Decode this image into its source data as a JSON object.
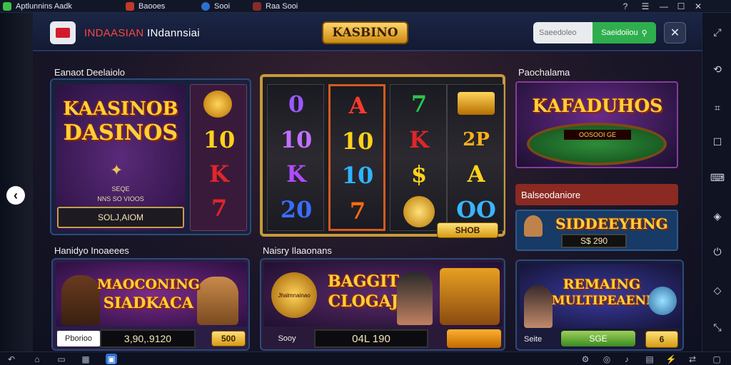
{
  "system_tabs": [
    {
      "label": "Aptlunnins Aadk"
    },
    {
      "label": "Baooes"
    },
    {
      "label": "Sooi"
    },
    {
      "label": "Raa Sooi"
    }
  ],
  "app": {
    "brand_red": "INDAASIAN",
    "brand_white": "INdannsiai",
    "center_logo": "KASBINO",
    "search": {
      "placeholder": "Saeedoleo",
      "button_label": "Saeidoiiou"
    }
  },
  "panels": {
    "top_left": {
      "title": "Eanaot Deelaiolo",
      "headline_1": "KAASINOB",
      "headline_2": "DASINOS",
      "sub_1": "SEQE",
      "sub_2": "NNS SO VIOOS",
      "cta": "SOLJ,AIOM",
      "symbols": [
        "10",
        "K",
        "7"
      ]
    },
    "slot": {
      "reels": [
        [
          "0",
          "10",
          "K",
          "20"
        ],
        [
          "A",
          "10",
          "10",
          "7"
        ],
        [
          "7",
          "K",
          "$"
        ],
        [
          "2P",
          "A",
          "OO"
        ]
      ],
      "spin_label": "SHOB"
    },
    "top_right": {
      "title": "Paochalama",
      "headline": "KAFADUHOS",
      "table_text": "OOSOOI GE",
      "subtitle": "Balseodaniore",
      "promo": "SIDDEEYHNG",
      "promo_value": "S$ 290"
    },
    "bottom_left": {
      "title": "Hanidyo Inoaeees",
      "headline_1": "MAOCONING",
      "headline_2": "SIADKACA",
      "label": "Pborioo",
      "amount": "3,90,.9120",
      "badge": "500"
    },
    "bottom_center": {
      "title": "Naisry Ilaaonans",
      "badge_text": "Jhalmnainao",
      "headline_1": "BAGGIT",
      "headline_2": "CLOGAJ",
      "label": "Sooy",
      "amount": "04L 190"
    },
    "bottom_right": {
      "headline_1": "REMAING",
      "headline_2": "MULTIPEAENI",
      "value": "SGE",
      "label": "Seite",
      "badge": "6"
    }
  },
  "colors": {
    "accent_gold": "#ffcf3a",
    "search_green": "#2fae4e",
    "brand_red": "#ff4444",
    "panel_border": "#2e4a78"
  }
}
